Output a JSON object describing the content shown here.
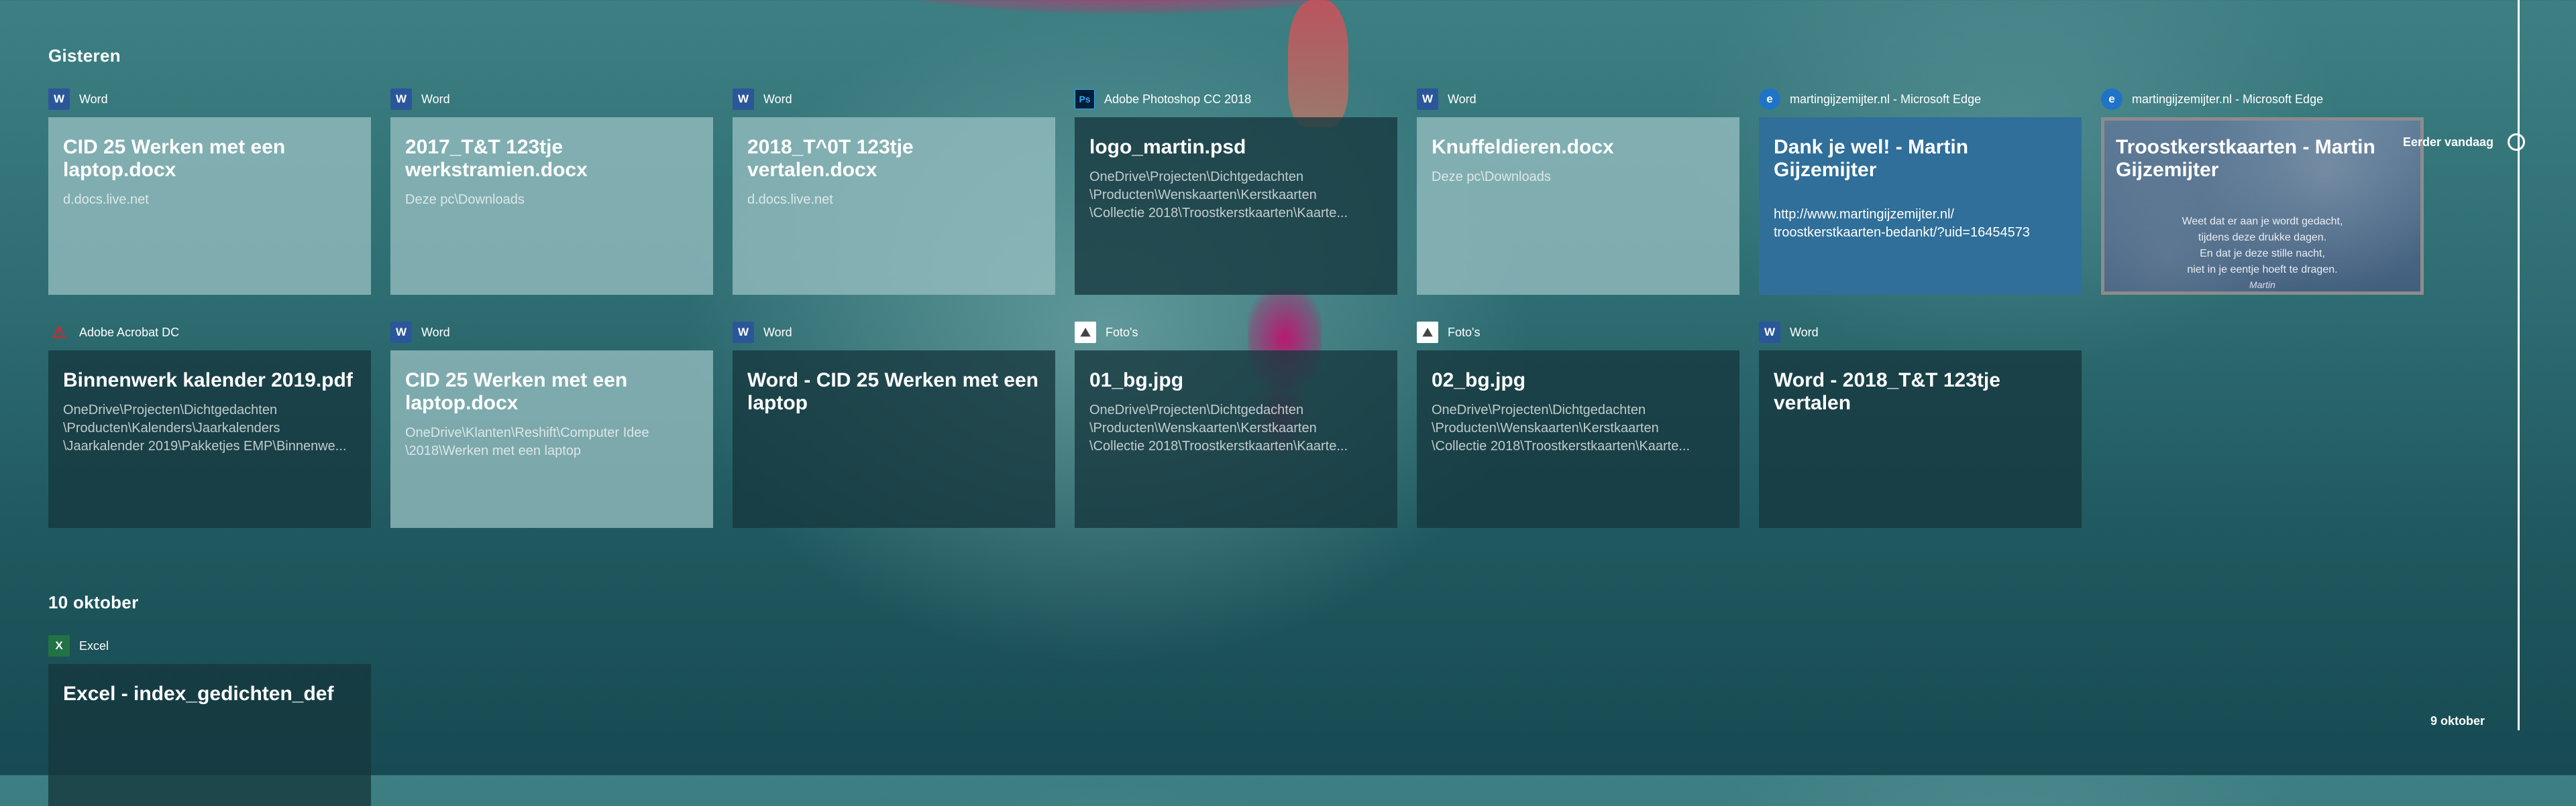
{
  "sections": [
    {
      "title": "Gisteren"
    },
    {
      "title": "10 oktober"
    }
  ],
  "cards": [
    {
      "app": "Word",
      "icon": "word-icon",
      "title": "CID 25 Werken met een laptop.docx",
      "sub": "d.docs.live.net"
    },
    {
      "app": "Word",
      "icon": "word-icon",
      "title": "2017_T&T 123tje werkstramien.docx",
      "sub": "Deze pc\\Downloads"
    },
    {
      "app": "Word",
      "icon": "word-icon",
      "title": "2018_T^0T 123tje vertalen.docx",
      "sub": "d.docs.live.net"
    },
    {
      "app": "Adobe Photoshop CC 2018",
      "icon": "photoshop-icon",
      "title": "logo_martin.psd",
      "sub": "OneDrive\\Projecten\\Dichtgedachten\n\\Producten\\Wenskaarten\\Kerstkaarten\n\\Collectie 2018\\Troostkerstkaarten\\Kaarte..."
    },
    {
      "app": "Word",
      "icon": "word-icon",
      "title": "Knuffeldieren.docx",
      "sub": "Deze pc\\Downloads"
    },
    {
      "app": "martingijzemijter.nl - Microsoft Edge",
      "icon": "edge-icon",
      "title": "Dank je wel! - Martin Gijzemijter",
      "sub": "http://www.martingijzemijter.nl/\ntroostkerstkaarten-bedankt/?uid=16454573"
    },
    {
      "app": "martingijzemijter.nl - Microsoft Edge",
      "icon": "edge-icon",
      "title": "Troostkerstkaarten - Martin Gijzemijter",
      "poem": "Weet dat er aan je wordt gedacht,\ntijdens deze drukke dagen.\nEn dat je deze stille nacht,\nniet in je eentje hoeft te dragen.",
      "signature": "Martin"
    },
    {
      "app": "Adobe Acrobat DC",
      "icon": "acrobat-icon",
      "title": "Binnenwerk kalender 2019.pdf",
      "sub": "OneDrive\\Projecten\\Dichtgedachten\n\\Producten\\Kalenders\\Jaarkalenders\n\\Jaarkalender 2019\\Pakketjes EMP\\Binnenwe..."
    },
    {
      "app": "Word",
      "icon": "word-icon",
      "title": "CID 25 Werken met een laptop.docx",
      "sub": "OneDrive\\Klanten\\Reshift\\Computer Idee\n\\2018\\Werken met een laptop"
    },
    {
      "app": "Word",
      "icon": "word-icon",
      "title": "Word - CID 25 Werken met een laptop",
      "sub": ""
    },
    {
      "app": "Foto's",
      "icon": "photos-icon",
      "title": "01_bg.jpg",
      "sub": "OneDrive\\Projecten\\Dichtgedachten\n\\Producten\\Wenskaarten\\Kerstkaarten\n\\Collectie 2018\\Troostkerstkaarten\\Kaarte..."
    },
    {
      "app": "Foto's",
      "icon": "photos-icon",
      "title": "02_bg.jpg",
      "sub": "OneDrive\\Projecten\\Dichtgedachten\n\\Producten\\Wenskaarten\\Kerstkaarten\n\\Collectie 2018\\Troostkerstkaarten\\Kaarte..."
    },
    {
      "app": "Word",
      "icon": "word-icon",
      "title": "Word - 2018_T&T 123tje vertalen",
      "sub": ""
    },
    {
      "app": "Excel",
      "icon": "excel-icon",
      "title": "Excel - index_gedichten_def",
      "sub": ""
    }
  ],
  "timeline": {
    "current_label": "Eerder vandaag",
    "bottom_label": "9 oktober"
  }
}
